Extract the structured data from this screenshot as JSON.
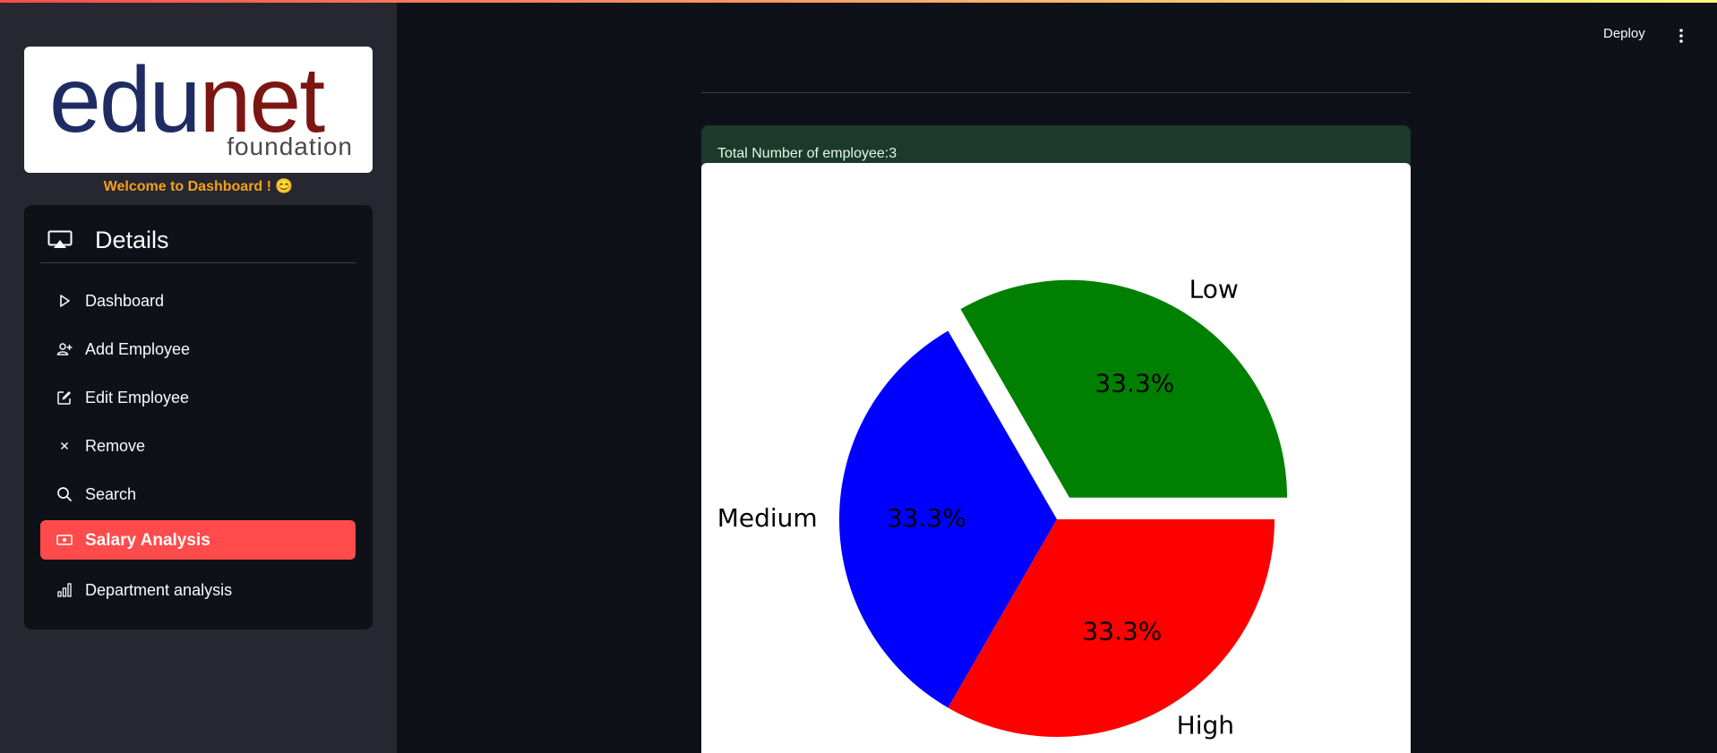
{
  "sidebar": {
    "logo": {
      "part1": "edu",
      "part2": "net",
      "sub": "foundation"
    },
    "welcome": "Welcome to Dashboard ! 😊",
    "menu_title": "Details",
    "items": [
      {
        "label": "Dashboard",
        "icon": "play-outline-icon"
      },
      {
        "label": "Add Employee",
        "icon": "person-add-icon"
      },
      {
        "label": "Edit Employee",
        "icon": "pencil-square-icon"
      },
      {
        "label": "Remove",
        "icon": "x-icon"
      },
      {
        "label": "Search",
        "icon": "search-icon"
      },
      {
        "label": "Salary Analysis",
        "icon": "cash-icon",
        "active": true
      },
      {
        "label": "Department analysis",
        "icon": "bar-chart-icon"
      }
    ]
  },
  "header": {
    "deploy_label": "Deploy"
  },
  "main": {
    "info_text": "Total Number of employee:3"
  },
  "colors": {
    "accent": "#ff4b4b",
    "low": "#008000",
    "medium": "#0000ff",
    "high": "#ff0000"
  },
  "chart_data": {
    "type": "pie",
    "slices": [
      {
        "label": "Low",
        "value": 33.3,
        "pct_label": "33.3%",
        "color": "#008000",
        "explode": true
      },
      {
        "label": "Medium",
        "value": 33.3,
        "pct_label": "33.3%",
        "color": "#0000ff"
      },
      {
        "label": "High",
        "value": 33.3,
        "pct_label": "33.3%",
        "color": "#ff0000"
      }
    ],
    "start_angle_deg": 0
  }
}
